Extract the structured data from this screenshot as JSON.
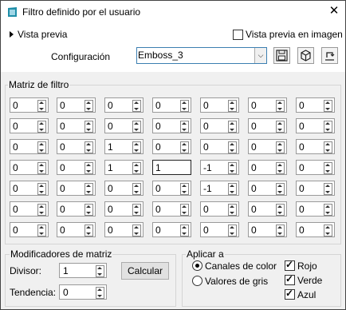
{
  "window": {
    "title": "Filtro definido por el usuario",
    "close_icon": "close-icon"
  },
  "preview": {
    "label": "Vista previa",
    "image_preview_label": "Vista previa en imagen",
    "image_preview_checked": false
  },
  "configuration": {
    "label": "Configuración",
    "value": "Emboss_3",
    "tools": [
      "save-icon",
      "cube-icon",
      "reset-icon"
    ]
  },
  "matrix": {
    "title": "Matriz de filtro",
    "rows": [
      [
        "0",
        "0",
        "0",
        "0",
        "0",
        "0",
        "0"
      ],
      [
        "0",
        "0",
        "0",
        "0",
        "0",
        "0",
        "0"
      ],
      [
        "0",
        "0",
        "1",
        "0",
        "0",
        "0",
        "0"
      ],
      [
        "0",
        "0",
        "1",
        "1",
        "-1",
        "0",
        "0"
      ],
      [
        "0",
        "0",
        "0",
        "0",
        "-1",
        "0",
        "0"
      ],
      [
        "0",
        "0",
        "0",
        "0",
        "0",
        "0",
        "0"
      ],
      [
        "0",
        "0",
        "0",
        "0",
        "0",
        "0",
        "0"
      ]
    ]
  },
  "modifiers": {
    "title": "Modificadores de matriz",
    "divisor_label": "Divisor:",
    "divisor_value": "1",
    "calc_label": "Calcular",
    "bias_label": "Tendencia:",
    "bias_value": "0"
  },
  "apply": {
    "title": "Aplicar a",
    "modes": [
      {
        "label": "Canales de color",
        "selected": true
      },
      {
        "label": "Valores de gris",
        "selected": false
      }
    ],
    "channels": [
      {
        "label": "Rojo",
        "checked": true
      },
      {
        "label": "Verde",
        "checked": true
      },
      {
        "label": "Azul",
        "checked": true
      }
    ]
  },
  "colors": {
    "focus_border": "#3c7fb1",
    "panel_bg": "#f0f0f0",
    "icon_teal": "#1f8ea8"
  }
}
